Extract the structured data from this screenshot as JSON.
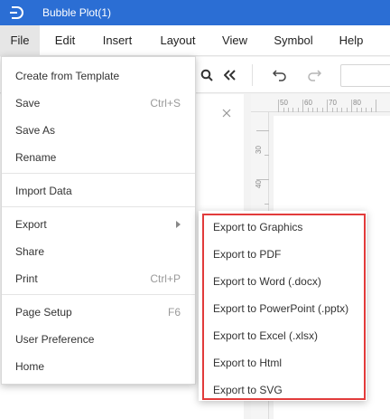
{
  "window": {
    "title": "Bubble Plot(1)",
    "accent_color": "#2b6ed4"
  },
  "menubar": {
    "items": [
      {
        "label": "File",
        "active": true
      },
      {
        "label": "Edit"
      },
      {
        "label": "Insert"
      },
      {
        "label": "Layout"
      },
      {
        "label": "View"
      },
      {
        "label": "Symbol"
      },
      {
        "label": "Help"
      }
    ]
  },
  "toolbar": {
    "icons": [
      "search-icon",
      "collapse-double-chevron-icon",
      "undo-icon",
      "redo-icon"
    ]
  },
  "rulers": {
    "top_ticks": [
      "50",
      "60",
      "70",
      "80"
    ],
    "left_ticks": [
      "30",
      "40"
    ]
  },
  "file_menu": {
    "items": [
      {
        "label": "Create from Template"
      },
      {
        "label": "Save",
        "shortcut": "Ctrl+S"
      },
      {
        "label": "Save As"
      },
      {
        "label": "Rename"
      },
      {
        "label": "Import Data"
      },
      {
        "label": "Export",
        "submenu": true
      },
      {
        "label": "Share"
      },
      {
        "label": "Print",
        "shortcut": "Ctrl+P"
      },
      {
        "label": "Page Setup",
        "shortcut": "F6"
      },
      {
        "label": "User Preference"
      },
      {
        "label": "Home"
      }
    ]
  },
  "export_menu": {
    "highlight_color": "#e23b3b",
    "items": [
      {
        "label": "Export to Graphics"
      },
      {
        "label": "Export to PDF"
      },
      {
        "label": "Export to Word (.docx)"
      },
      {
        "label": "Export to PowerPoint (.pptx)"
      },
      {
        "label": "Export to Excel (.xlsx)"
      },
      {
        "label": "Export to Html"
      },
      {
        "label": "Export to SVG"
      }
    ]
  }
}
